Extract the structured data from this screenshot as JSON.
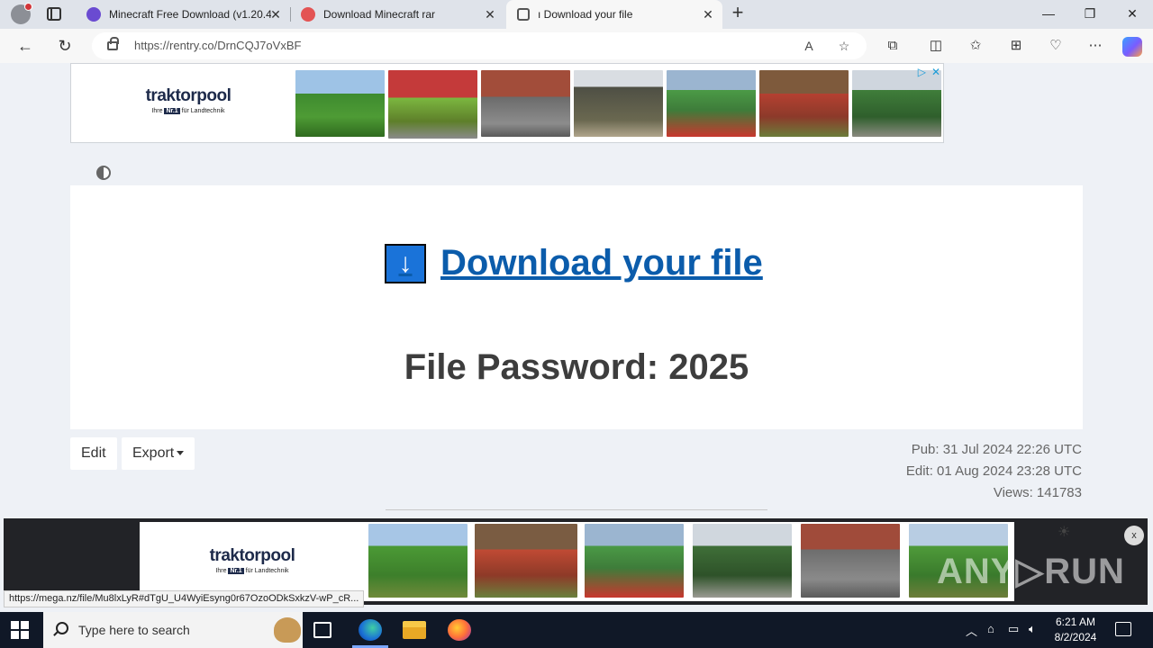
{
  "browser": {
    "tabs": [
      {
        "title": "Minecraft Free Download (v1.20.4",
        "favicon_color": "#6a4bd1"
      },
      {
        "title": "Download Minecraft rar",
        "favicon_color": "#e35454"
      },
      {
        "title": "ı Download your file",
        "favicon_color": "#555555"
      }
    ],
    "url": "https://rentry.co/DrnCQJ7oVxBF"
  },
  "ads": {
    "brand": "traktorpool",
    "tagline_prefix": "Ihre",
    "tagline_badge": "Nr.1",
    "tagline_suffix": "für Landtechnik",
    "bottom_close": "x",
    "adchoices_close": "✕"
  },
  "page": {
    "download_arrow": "↓",
    "download_link": "Download your file",
    "password": "File Password: 2025",
    "edit_button": "Edit",
    "export_button": "Export",
    "pub": "Pub: 31 Jul 2024 22:26 UTC",
    "edit": "Edit: 01 Aug 2024 23:28 UTC",
    "views": "Views: 141783"
  },
  "status_url": "https://mega.nz/file/Mu8lxLyR#dTgU_U4WyiEsyng0r67OzoODkSxkzV-wP_cR...",
  "watermark": "ANY▷RUN",
  "taskbar": {
    "search_placeholder": "Type here to search",
    "time": "6:21 AM",
    "date": "8/2/2024"
  },
  "colors": {
    "link": "#0b5cab",
    "arrow_button": "#1a73d9",
    "taskbar": "#101827"
  }
}
